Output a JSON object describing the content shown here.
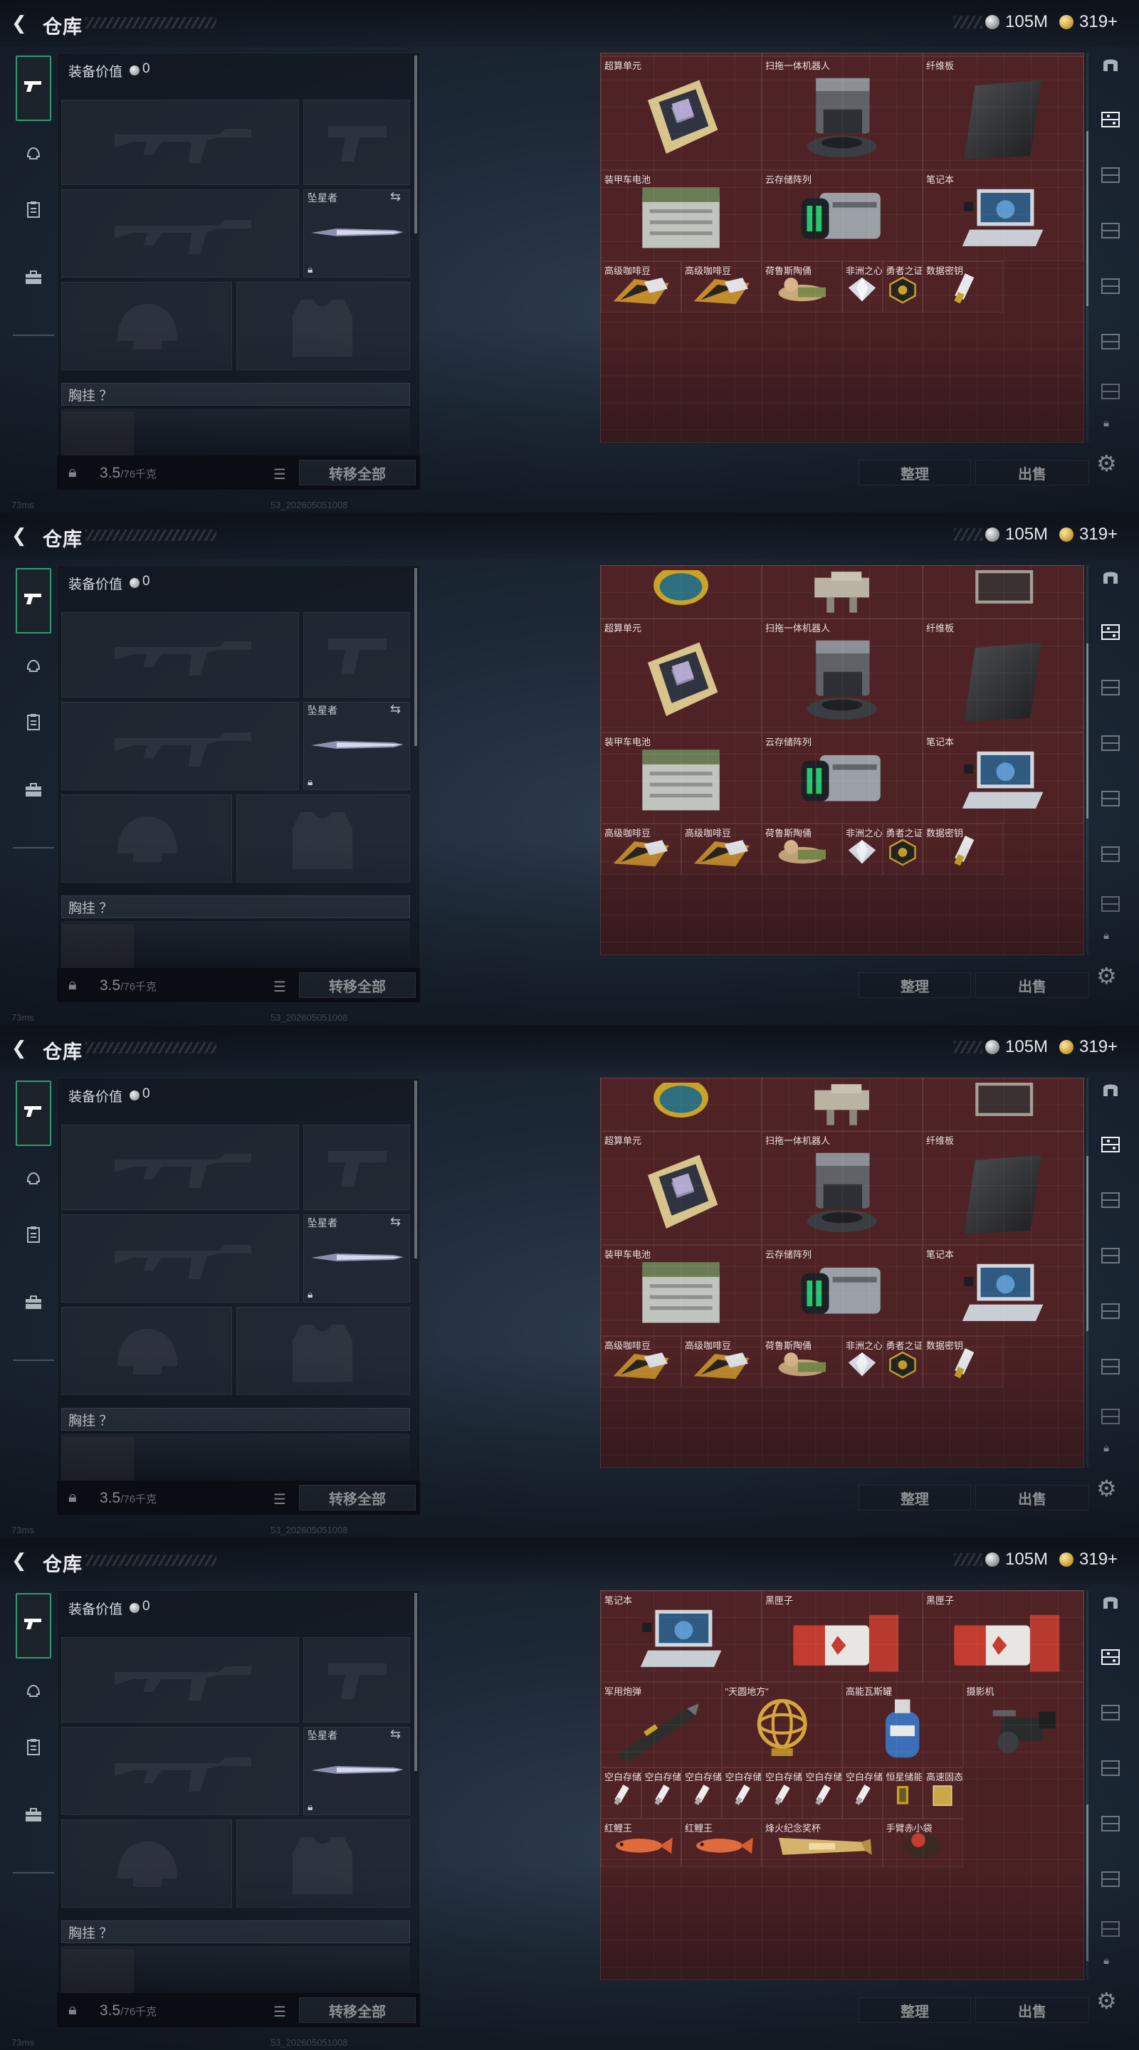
{
  "header": {
    "title": "仓库",
    "silver_amount": "105M",
    "gold_amount": "319+"
  },
  "sidebar": {
    "categories": [
      {
        "name": "weapons",
        "icon": "pistol-icon"
      },
      {
        "name": "helmet",
        "icon": "helmet-icon"
      },
      {
        "name": "armor",
        "icon": "clipboard-icon"
      },
      {
        "name": "bags",
        "icon": "briefcase-icon"
      }
    ]
  },
  "equipment": {
    "value_label": "装备价值",
    "value": "0",
    "melee_label": "坠星者",
    "chest_rig_label": "胸挂 ？",
    "weight": "3.5",
    "weight_max": "/76千克",
    "transfer_all_label": "转移全部"
  },
  "warehouse": {
    "sort_label": "整理",
    "sell_label": "出售"
  },
  "status": {
    "ping": "73ms",
    "build": "53_202605051008"
  },
  "frames": [
    {
      "thumb": {
        "top": 0.2,
        "height": 0.45
      },
      "items": [
        {
          "name": "",
          "icon": "jade-vase-icon"
        },
        {
          "name": "",
          "icon": "tank-model-icon"
        },
        {
          "name": "",
          "icon": "tablet-icon"
        },
        {
          "name": "超算单元",
          "icon": "supercomputer-unit-icon"
        },
        {
          "name": "扫拖一体机器人",
          "icon": "mopping-robot-icon"
        },
        {
          "name": "纤维板",
          "icon": "fiber-board-icon"
        },
        {
          "name": "装甲车电池",
          "icon": "armored-battery-icon"
        },
        {
          "name": "云存储阵列",
          "icon": "cloud-storage-icon"
        },
        {
          "name": "笔记本",
          "icon": "laptop-icon"
        },
        {
          "name": "高级咖啡豆",
          "icon": "coffee-beans-icon"
        },
        {
          "name": "高级咖啡豆",
          "icon": "coffee-beans-icon"
        },
        {
          "name": "荷鲁斯陶俑",
          "icon": "ceramic-figure-icon"
        },
        {
          "name": "非洲之心",
          "icon": "diamond-icon"
        },
        {
          "name": "勇者之证",
          "icon": "badge-icon"
        },
        {
          "name": "数据密钥",
          "icon": "usb-key-icon"
        }
      ]
    },
    {
      "thumb": {
        "top": 0.2,
        "height": 0.45
      },
      "items": [
        {
          "name": "",
          "icon": "jade-vase-icon"
        },
        {
          "name": "",
          "icon": "tank-model-icon"
        },
        {
          "name": "",
          "icon": "tablet-icon"
        },
        {
          "name": "超算单元",
          "icon": "supercomputer-unit-icon"
        },
        {
          "name": "扫拖一体机器人",
          "icon": "mopping-robot-icon"
        },
        {
          "name": "纤维板",
          "icon": "fiber-board-icon"
        },
        {
          "name": "装甲车电池",
          "icon": "armored-battery-icon"
        },
        {
          "name": "云存储阵列",
          "icon": "cloud-storage-icon"
        },
        {
          "name": "笔记本",
          "icon": "laptop-icon"
        },
        {
          "name": "高级咖啡豆",
          "icon": "coffee-beans-icon"
        },
        {
          "name": "高级咖啡豆",
          "icon": "coffee-beans-icon"
        },
        {
          "name": "荷鲁斯陶俑",
          "icon": "ceramic-figure-icon"
        },
        {
          "name": "非洲之心",
          "icon": "diamond-icon"
        },
        {
          "name": "勇者之证",
          "icon": "badge-icon"
        },
        {
          "name": "数据密钥",
          "icon": "usb-key-icon"
        }
      ]
    },
    {
      "thumb": {
        "top": 0.2,
        "height": 0.45
      },
      "items": [
        {
          "name": "",
          "icon": "jade-vase-icon"
        },
        {
          "name": "",
          "icon": "tank-model-icon"
        },
        {
          "name": "",
          "icon": "tablet-icon"
        },
        {
          "name": "超算单元",
          "icon": "supercomputer-unit-icon"
        },
        {
          "name": "扫拖一体机器人",
          "icon": "mopping-robot-icon"
        },
        {
          "name": "纤维板",
          "icon": "fiber-board-icon"
        },
        {
          "name": "装甲车电池",
          "icon": "armored-battery-icon"
        },
        {
          "name": "云存储阵列",
          "icon": "cloud-storage-icon"
        },
        {
          "name": "笔记本",
          "icon": "laptop-icon"
        },
        {
          "name": "高级咖啡豆",
          "icon": "coffee-beans-icon"
        },
        {
          "name": "高级咖啡豆",
          "icon": "coffee-beans-icon"
        },
        {
          "name": "荷鲁斯陶俑",
          "icon": "ceramic-figure-icon"
        },
        {
          "name": "非洲之心",
          "icon": "diamond-icon"
        },
        {
          "name": "勇者之证",
          "icon": "badge-icon"
        },
        {
          "name": "数据密钥",
          "icon": "usb-key-icon"
        }
      ]
    },
    {
      "thumb": {
        "top": 0.55,
        "height": 0.4
      },
      "items": [
        {
          "name": "笔记本",
          "icon": "laptop-icon"
        },
        {
          "name": "黑匣子",
          "icon": "black-box-icon"
        },
        {
          "name": "黑匣子",
          "icon": "black-box-icon"
        },
        {
          "name": "军用炮弹",
          "icon": "artillery-shell-icon"
        },
        {
          "name": "\"天圆地方\"",
          "icon": "armillary-sphere-icon"
        },
        {
          "name": "高能瓦斯罐",
          "icon": "gas-canister-icon"
        },
        {
          "name": "摄影机",
          "icon": "video-camera-icon"
        },
        {
          "name": "空白存储",
          "icon": "usb-drive-icon"
        },
        {
          "name": "空白存储",
          "icon": "usb-drive-icon"
        },
        {
          "name": "空白存储",
          "icon": "usb-drive-icon"
        },
        {
          "name": "空白存储",
          "icon": "usb-drive-icon"
        },
        {
          "name": "空白存储",
          "icon": "usb-drive-icon"
        },
        {
          "name": "空白存储",
          "icon": "usb-drive-icon"
        },
        {
          "name": "空白存储",
          "icon": "usb-drive-icon"
        },
        {
          "name": "恒星储能器",
          "icon": "stellar-capacitor-icon"
        },
        {
          "name": "高速固态...",
          "icon": "ssd-icon"
        },
        {
          "name": "红鲤王",
          "icon": "red-carp-icon"
        },
        {
          "name": "红鲤王",
          "icon": "red-carp-icon"
        },
        {
          "name": "烽火纪念奖杯",
          "icon": "trophy-icon"
        },
        {
          "name": "手臂赤小袋",
          "icon": "arm-pouch-icon"
        }
      ]
    }
  ]
}
